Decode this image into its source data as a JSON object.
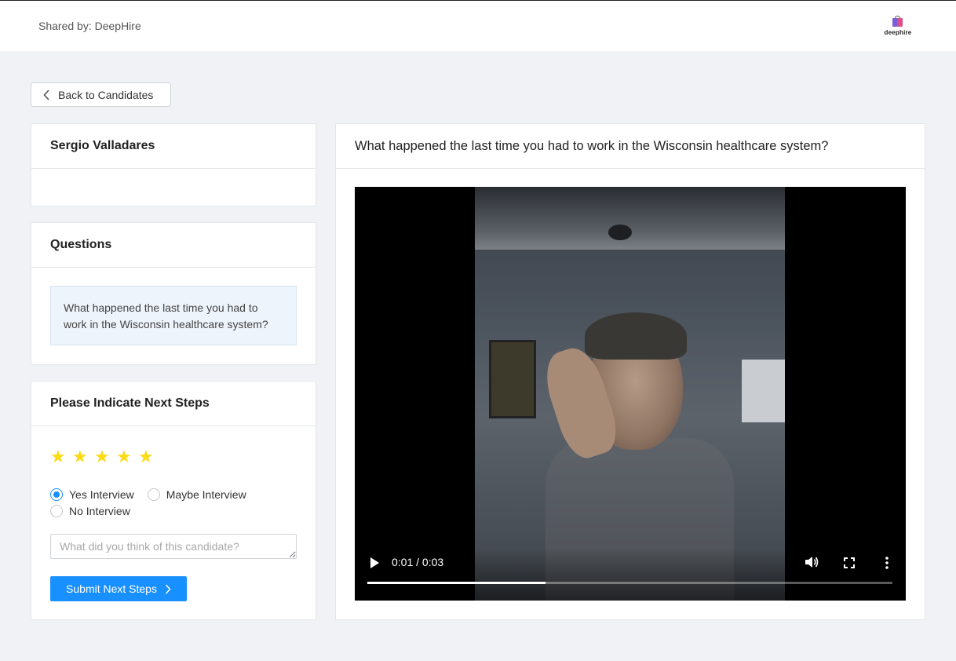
{
  "header": {
    "shared_by": "Shared by: DeepHire",
    "logo_text": "deephire"
  },
  "back_button": {
    "label": "Back to Candidates"
  },
  "candidate": {
    "name": "Sergio Valladares"
  },
  "questions": {
    "title": "Questions",
    "items": [
      {
        "label": "What happened the last time you had to work in the Wisconsin healthcare system?"
      }
    ]
  },
  "next_steps": {
    "title": "Please Indicate Next Steps",
    "rating": 5,
    "rating_max": 5,
    "options": [
      {
        "label": "Yes Interview",
        "selected": true
      },
      {
        "label": "Maybe Interview",
        "selected": false
      },
      {
        "label": "No Interview",
        "selected": false
      }
    ],
    "comment_placeholder": "What did you think of this candidate?",
    "submit_label": "Submit Next Steps"
  },
  "video": {
    "question_title": "What happened the last time you had to work in the Wisconsin healthcare system?",
    "time": "0:01 / 0:03",
    "progress_fraction": 0.34
  },
  "colors": {
    "accent": "#1890ff",
    "star": "#fadb14",
    "page_bg": "#f0f2f5"
  }
}
